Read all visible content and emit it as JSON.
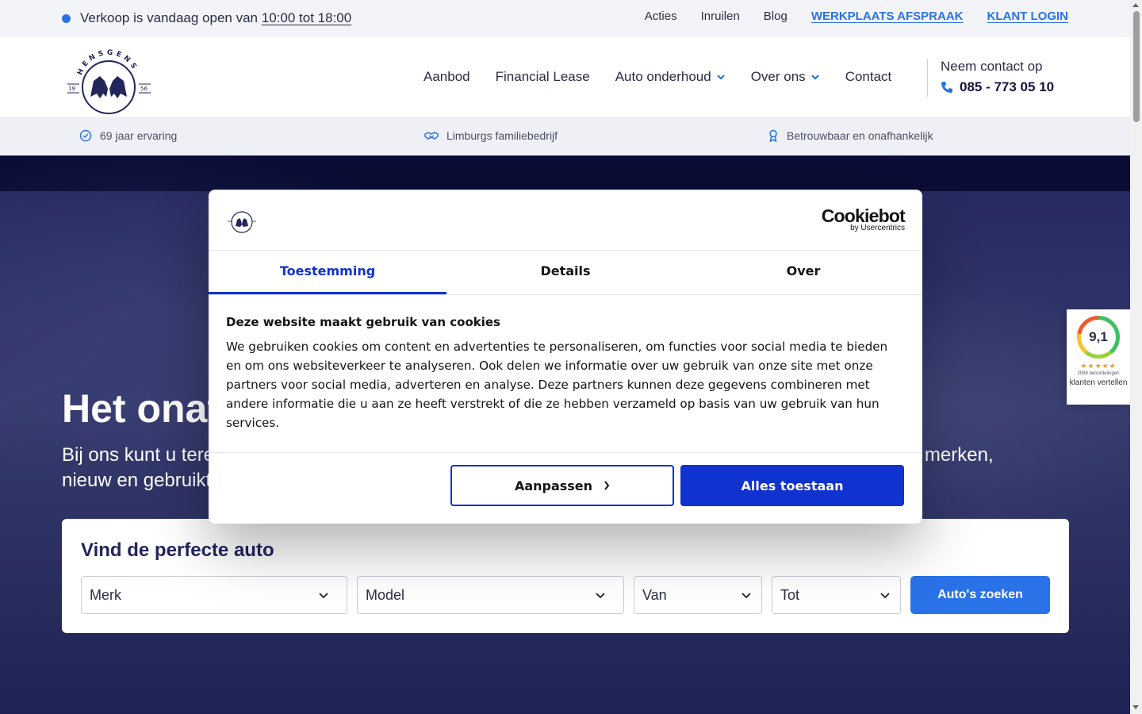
{
  "topbar": {
    "open_prefix": "Verkoop is vandaag open van ",
    "open_hours": "10:00 tot 18:00",
    "links": [
      "Acties",
      "Inruilen",
      "Blog"
    ],
    "workshop": "WERKPLAATS AFSPRAAK",
    "login": "KLANT LOGIN"
  },
  "header": {
    "logo_text": "HENSGENS",
    "logo_year_left": "19",
    "logo_year_right": "56",
    "nav": [
      "Aanbod",
      "Financial Lease",
      "Auto onderhoud",
      "Over ons",
      "Contact"
    ],
    "contact_label": "Neem contact op",
    "phone": "085 - 773 05 10"
  },
  "usp": [
    "69 jaar ervaring",
    "Limburgs familiebedrijf",
    "Betrouwbaar en onafhankelijk"
  ],
  "hero": {
    "title": "Het onafhankelijke autobedrijf van Limburg",
    "subtitle": "Bij ons kunt u terecht voor de aankoop van een nieuwe of gebruikte auto. Wij verkopen auto's van alle merken, nieuw en gebruikt."
  },
  "finder": {
    "title": "Vind de perfecte auto",
    "brand": "Merk",
    "model": "Model",
    "from": "Van",
    "to": "Tot",
    "button": "Auto's zoeken"
  },
  "badge": {
    "score": "9,1",
    "stars": "★★★★★",
    "count": "2588 beoordelingen",
    "text": "klanten vertellen"
  },
  "cookie": {
    "brand": "Cookiebot",
    "brand_sub": "by Usercentrics",
    "tabs": [
      "Toestemming",
      "Details",
      "Over"
    ],
    "heading": "Deze website maakt gebruik van cookies",
    "body": "We gebruiken cookies om content en advertenties te personaliseren, om functies voor social media te bieden en om ons websiteverkeer te analyseren. Ook delen we informatie over uw gebruik van onze site met onze partners voor social media, adverteren en analyse. Deze partners kunnen deze gegevens combineren met andere informatie die u aan ze heeft verstrekt of die ze hebben verzameld op basis van uw gebruik van hun services.",
    "customize": "Aanpassen",
    "accept": "Alles toestaan"
  },
  "colors": {
    "accent": "#2a72e8",
    "cookie_blue": "#1032cf",
    "navy": "#23265a"
  }
}
